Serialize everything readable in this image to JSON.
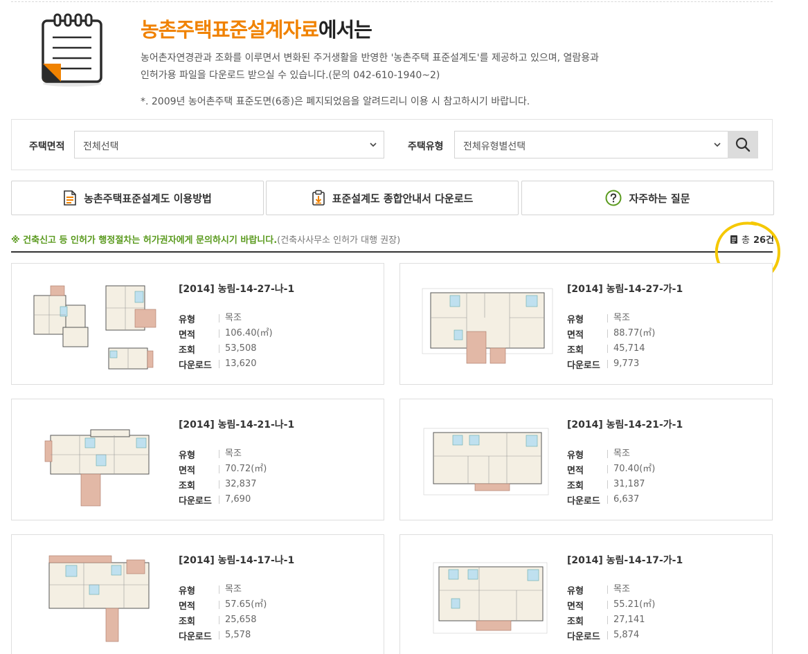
{
  "header": {
    "title_accent": "농촌주택표준설계자료",
    "title_rest": "에서는",
    "desc_line1": "농어촌자연경관과 조화를 이루면서 변화된 주거생활을 반영한 '농촌주택 표준설계도'를 제공하고 있으며, 열람용과",
    "desc_line2": "인허가용 파일을 다운로드 받으실 수 있습니다.(문의 042-610-1940~2)",
    "notice": "*. 2009년 농어촌주택 표준도면(6종)은 폐지되었음을 알려드리니 이용 시 참고하시기 바랍니다."
  },
  "search": {
    "area_label": "주택면적",
    "area_value": "전체선택",
    "type_label": "주택유형",
    "type_value": "전체유형별선택"
  },
  "guide_buttons": [
    {
      "label": "농촌주택표준설계도 이용방법",
      "icon": "document-icon"
    },
    {
      "label": "표준설계도 종합안내서 다운로드",
      "icon": "clipboard-download-icon"
    },
    {
      "label": "자주하는 질문",
      "icon": "question-circle-icon"
    }
  ],
  "info": {
    "notice_bold": "※ 건축신고 등 인허가 행정절차는 허가권자에게 문의하시기 바랍니다.",
    "notice_sub": "(건축사사무소 인허가 대행 권장)",
    "total_prefix": "총",
    "total_count": "26건"
  },
  "labels": {
    "type": "유형",
    "area": "면적",
    "views": "조회",
    "downloads": "다운로드"
  },
  "cards": [
    {
      "title": "[2014] 농림-14-27-나-1",
      "type": "목조",
      "area": "106.40(㎡)",
      "views": "53,508",
      "downloads": "13,620"
    },
    {
      "title": "[2014] 농림-14-27-가-1",
      "type": "목조",
      "area": "88.77(㎡)",
      "views": "45,714",
      "downloads": "9,773"
    },
    {
      "title": "[2014] 농림-14-21-나-1",
      "type": "목조",
      "area": "70.72(㎡)",
      "views": "32,837",
      "downloads": "7,690"
    },
    {
      "title": "[2014] 농림-14-21-가-1",
      "type": "목조",
      "area": "70.40(㎡)",
      "views": "31,187",
      "downloads": "6,637"
    },
    {
      "title": "[2014] 농림-14-17-나-1",
      "type": "목조",
      "area": "57.65(㎡)",
      "views": "25,658",
      "downloads": "5,578"
    },
    {
      "title": "[2014] 농림-14-17-가-1",
      "type": "목조",
      "area": "55.21(㎡)",
      "views": "27,141",
      "downloads": "5,874"
    }
  ],
  "colors": {
    "accent": "#f08200",
    "notice_green": "#5a9a1e",
    "annotation": "#f5c800"
  }
}
